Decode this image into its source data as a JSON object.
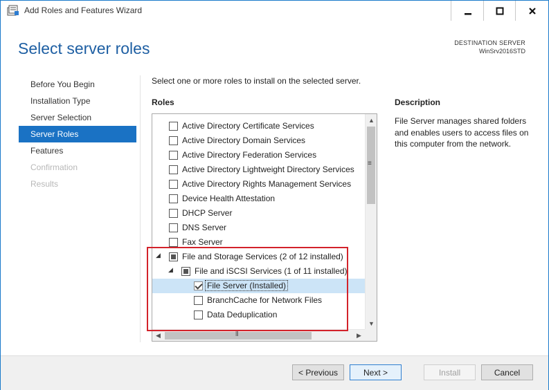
{
  "window": {
    "title": "Add Roles and Features Wizard",
    "accent_color": "#1979ca",
    "controls": {
      "minimize_icon": "minimize-icon",
      "maximize_icon": "maximize-icon",
      "close_icon": "close-icon"
    }
  },
  "header": {
    "page_title": "Select server roles",
    "destination_label": "DESTINATION SERVER",
    "destination_name": "WinSrv2016STD"
  },
  "nav": {
    "items": [
      {
        "label": "Before You Begin",
        "state": "normal"
      },
      {
        "label": "Installation Type",
        "state": "normal"
      },
      {
        "label": "Server Selection",
        "state": "normal"
      },
      {
        "label": "Server Roles",
        "state": "active"
      },
      {
        "label": "Features",
        "state": "normal"
      },
      {
        "label": "Confirmation",
        "state": "disabled"
      },
      {
        "label": "Results",
        "state": "disabled"
      }
    ]
  },
  "main": {
    "instruction": "Select one or more roles to install on the selected server.",
    "roles_heading": "Roles",
    "roles": [
      {
        "label": "Active Directory Certificate Services",
        "state": "unchecked"
      },
      {
        "label": "Active Directory Domain Services",
        "state": "unchecked"
      },
      {
        "label": "Active Directory Federation Services",
        "state": "unchecked"
      },
      {
        "label": "Active Directory Lightweight Directory Services",
        "state": "unchecked"
      },
      {
        "label": "Active Directory Rights Management Services",
        "state": "unchecked"
      },
      {
        "label": "Device Health Attestation",
        "state": "unchecked"
      },
      {
        "label": "DHCP Server",
        "state": "unchecked"
      },
      {
        "label": "DNS Server",
        "state": "unchecked"
      },
      {
        "label": "Fax Server",
        "state": "unchecked"
      },
      {
        "label": "File and Storage Services (2 of 12 installed)",
        "state": "partial",
        "expanded": true
      },
      {
        "label": "File and iSCSI Services (1 of 11 installed)",
        "state": "partial",
        "expanded": true
      },
      {
        "label": "File Server (Installed)",
        "state": "checked",
        "selected": true
      },
      {
        "label": "BranchCache for Network Files",
        "state": "unchecked"
      },
      {
        "label": "Data Deduplication",
        "state": "unchecked"
      }
    ],
    "description_heading": "Description",
    "description_text": "File Server manages shared folders and enables users to access files on this computer from the network."
  },
  "buttons": {
    "previous": "< Previous",
    "next": "Next >",
    "install": "Install",
    "cancel": "Cancel"
  },
  "annotation": {
    "highlight_color": "#d3222a"
  }
}
